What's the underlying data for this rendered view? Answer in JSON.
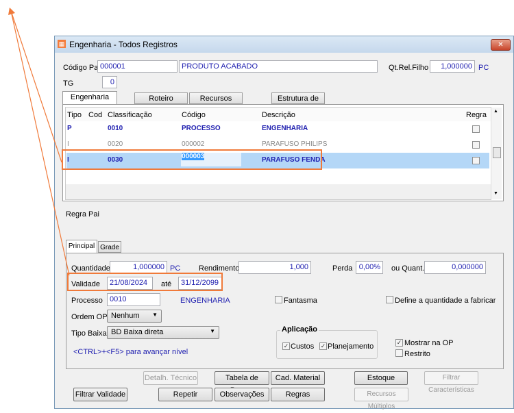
{
  "window": {
    "title": "Engenharia - Todos Registros",
    "close": "✕"
  },
  "header": {
    "codigo_pai_label": "Código Pai",
    "codigo_pai": "000001",
    "descricao": "PRODUTO ACABADO",
    "qt_rel_label": "Qt.Rel.Filho",
    "qt_rel": "1,000000",
    "qt_unit": "PC",
    "tg_label": "TG",
    "tg": "0"
  },
  "tabs": [
    "Engenharia",
    "Roteiro",
    "Recursos",
    "Estrutura de Produto"
  ],
  "grid": {
    "columns": [
      "Tipo",
      "Cod",
      "Classificação",
      "Código",
      "Descrição",
      "Regra"
    ],
    "rows": [
      {
        "tipo": "P",
        "cod": "",
        "classificacao": "0010",
        "codigo": "PROCESSO",
        "descricao": "ENGENHARIA",
        "regra": false
      },
      {
        "tipo": "I",
        "cod": "",
        "classificacao": "0020",
        "codigo": "000002",
        "descricao": "PARAFUSO PHILIPS",
        "regra": false
      },
      {
        "tipo": "I",
        "cod": "",
        "classificacao": "0030",
        "codigo": "000003",
        "descricao": "PARAFUSO FENDA",
        "regra": false
      }
    ]
  },
  "regra_pai_label": "Regra Pai",
  "subtabs": [
    "Principal",
    "Grade"
  ],
  "form": {
    "quantidade_label": "Quantidade",
    "quantidade": "1,000000",
    "quantidade_unit": "PC",
    "rendimento_label": "Rendimento",
    "rendimento": "1,000",
    "perda_label": "Perda",
    "perda": "0,00%",
    "ou_quant_label": "ou Quant.",
    "ou_quant": "0,000000",
    "validade_label": "Validade",
    "validade_de": "21/08/2024",
    "ate_label": "até",
    "validade_ate": "31/12/2099",
    "processo_label": "Processo",
    "processo": "0010",
    "processo_desc": "ENGENHARIA",
    "fantasma_label": "Fantasma",
    "define_label": "Define a quantidade a fabricar",
    "ordem_op_label": "Ordem OP",
    "ordem_op": "Nenhum",
    "tipo_baixa_label": "Tipo Baixa",
    "tipo_baixa": "BD Baixa direta",
    "hint": "<CTRL>+<F5> para avançar nível",
    "aplicacao_label": "Aplicação",
    "custos_label": "Custos",
    "planejamento_label": "Planejamento",
    "mostrar_label": "Mostrar na OP",
    "restrito_label": "Restrito"
  },
  "buttons": {
    "detalh": "Detalh. Técnico",
    "tabela": "Tabela de Preços",
    "cad_material": "Cad. Material",
    "estoque": "Estoque",
    "filtrar_carac": "Filtrar Características",
    "filtrar_validade": "Filtrar Validade",
    "repetir": "Repetir",
    "observacoes": "Observações",
    "regras": "Regras",
    "recursos_multiplos": "Recursos Múltiplos"
  },
  "colors": {
    "annotation": "#f07a3a",
    "selection": "#b4d7f7",
    "value_text": "#2020b0"
  }
}
